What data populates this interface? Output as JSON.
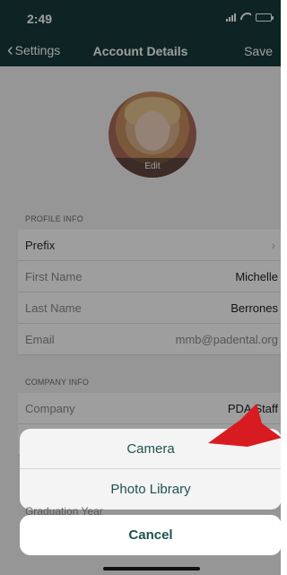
{
  "status_bar": {
    "time": "2:49"
  },
  "nav": {
    "back_label": "Settings",
    "title": "Account Details",
    "save_label": "Save"
  },
  "avatar": {
    "edit_label": "Edit"
  },
  "profile_info": {
    "header": "PROFILE INFO",
    "rows": [
      {
        "label": "Prefix",
        "value": ""
      },
      {
        "label": "First Name",
        "value": "Michelle"
      },
      {
        "label": "Last Name",
        "value": "Berrones"
      },
      {
        "label": "Email",
        "value": "mmb@padental.org"
      }
    ]
  },
  "company_info": {
    "header": "COMPANY INFO",
    "rows": [
      {
        "label": "Company",
        "value": "PDA Staff"
      }
    ]
  },
  "peek_row": {
    "label": "Graduation Year"
  },
  "action_sheet": {
    "options": [
      "Camera",
      "Photo Library"
    ],
    "cancel_label": "Cancel"
  },
  "annotation": {
    "arrow_color": "#d81b21"
  },
  "colors": {
    "nav_bg": "#173b3b",
    "accent": "#205252"
  }
}
